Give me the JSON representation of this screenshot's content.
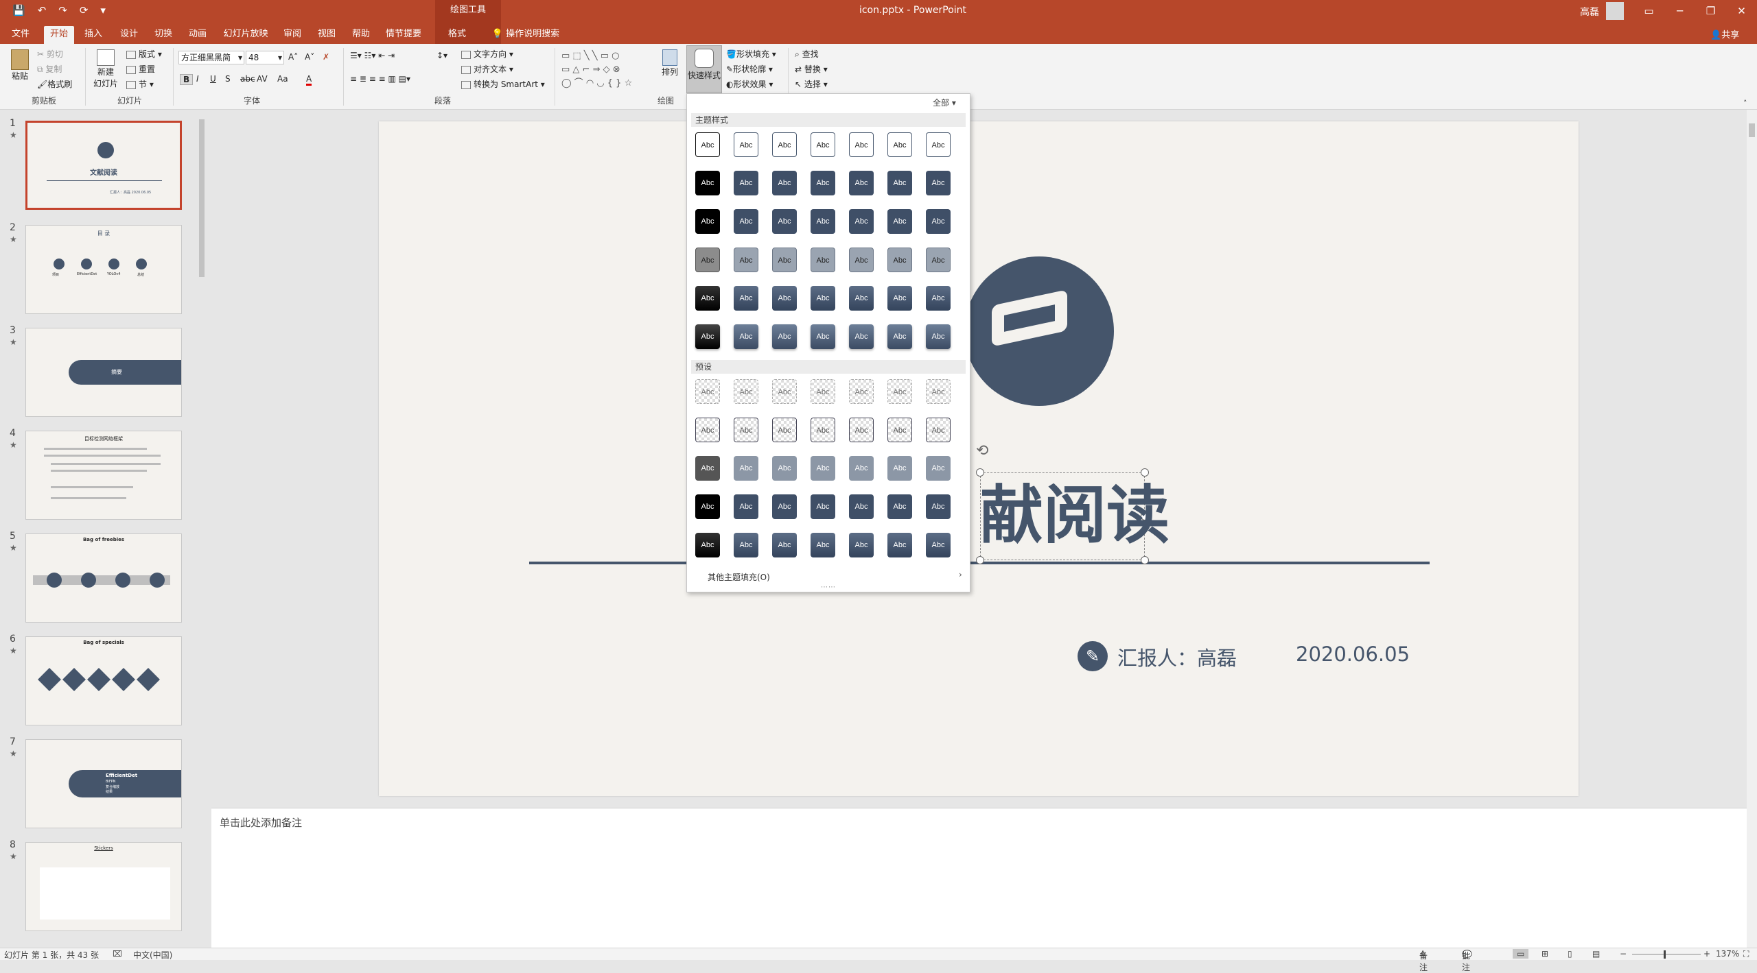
{
  "titlebar": {
    "context_label": "绘图工具",
    "title": "icon.pptx  -  PowerPoint",
    "user": "高磊",
    "qat": [
      "💾",
      "↶",
      "↷",
      "⟳",
      "▾"
    ],
    "win_buttons": [
      "▭",
      "─",
      "❐",
      "✕"
    ]
  },
  "tabs": [
    "文件",
    "开始",
    "插入",
    "设计",
    "切换",
    "动画",
    "幻灯片放映",
    "审阅",
    "视图",
    "帮助",
    "情节提要",
    "格式"
  ],
  "active_tab": "开始",
  "tell_me": "操作说明搜索",
  "share": "共享",
  "ribbon": {
    "clipboard": {
      "paste": "粘贴",
      "cut": "剪切",
      "copy": "复制",
      "format_painter": "格式刷",
      "label": "剪贴板"
    },
    "slides": {
      "new_slide": "新建",
      "new_slide2": "幻灯片",
      "layout": "版式",
      "reset": "重置",
      "section": "节",
      "label": "幻灯片"
    },
    "font": {
      "name": "方正细黑黑简",
      "size": "48",
      "label": "字体",
      "buttons": [
        "B",
        "I",
        "U",
        "S",
        "abc",
        "AV",
        "Aa",
        "A"
      ]
    },
    "paragraph": {
      "text_direction": "文字方向",
      "align_text": "对齐文本",
      "smartart": "转换为 SmartArt",
      "label": "段落"
    },
    "drawing": {
      "arrange": "排列",
      "quick_styles": "快速样式",
      "fill": "形状填充",
      "outline": "形状轮廓",
      "effects": "形状效果",
      "label": "绘图"
    },
    "editing": {
      "find": "查找",
      "replace": "替换",
      "select": "选择"
    }
  },
  "gallery": {
    "all": "全部",
    "section1": "主题样式",
    "section2": "预设",
    "swatch_text": "Abc",
    "more": "其他主题填充(O)"
  },
  "thumbnails": [
    {
      "num": "1",
      "title": "文献阅读",
      "meta": "汇报人：高磊    2020.06.05"
    },
    {
      "num": "2",
      "title": "目  录",
      "items": [
        "项目",
        "EfficientDet",
        "YOLOv4",
        "总结"
      ]
    },
    {
      "num": "3",
      "title": "摘要"
    },
    {
      "num": "4",
      "title": "目标检测网络框架"
    },
    {
      "num": "5",
      "title": "Bag of freebies"
    },
    {
      "num": "6",
      "title": "Bag of specials"
    },
    {
      "num": "7",
      "title": "EfficientDet",
      "items": [
        "BiFPN",
        "复合缩放",
        "结果"
      ]
    },
    {
      "num": "8",
      "title": "Stickers"
    }
  ],
  "slide": {
    "title_visible": "献阅读",
    "reporter": "汇报人：高磊",
    "date": "2020.06.05"
  },
  "notes_placeholder": "单击此处添加备注",
  "status": {
    "slide_info": "幻灯片 第 1 张，共 43 张",
    "language": "中文(中国)",
    "notes": "备注",
    "comments": "批注",
    "zoom": "137%"
  },
  "colors": {
    "accent": "#b7472a",
    "slide_dark": "#45556b"
  }
}
